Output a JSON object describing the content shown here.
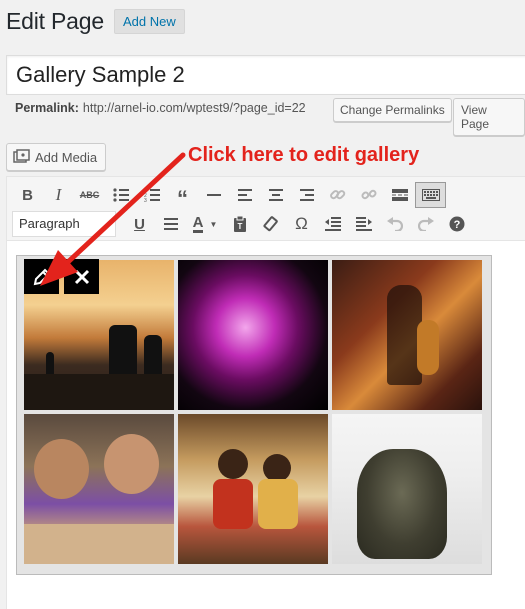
{
  "header": {
    "title": "Edit Page",
    "add_new": "Add New"
  },
  "post": {
    "title_value": "Gallery Sample 2"
  },
  "permalink": {
    "label": "Permalink:",
    "url": "http://arnel-io.com/wptest9/?page_id=22",
    "change_button": "Change Permalinks",
    "view_button": "View Page"
  },
  "media": {
    "add_media": "Add Media"
  },
  "callout": {
    "text": "Click here to edit gallery",
    "color": "#e3231c"
  },
  "toolbar": {
    "format_select": "Paragraph",
    "row1_icons": [
      "bold-icon",
      "italic-icon",
      "strikethrough-icon",
      "bullet-list-icon",
      "numbered-list-icon",
      "blockquote-icon",
      "horizontal-rule-icon",
      "align-left-icon",
      "align-center-icon",
      "align-right-icon",
      "link-icon",
      "unlink-icon",
      "read-more-icon",
      "toolbar-toggle-icon"
    ],
    "row2_icons": [
      "underline-icon",
      "justify-icon",
      "text-color-icon",
      "paste-text-icon",
      "clear-formatting-icon",
      "special-character-icon",
      "outdent-icon",
      "indent-icon",
      "undo-icon",
      "redo-icon",
      "help-icon"
    ]
  },
  "gallery": {
    "items": [
      "sunset-photo",
      "orchid-photo",
      "guitarist-photo",
      "family-photo",
      "women-photo",
      "statue-photo"
    ],
    "tools": [
      "edit-gallery-icon",
      "remove-gallery-icon"
    ]
  }
}
